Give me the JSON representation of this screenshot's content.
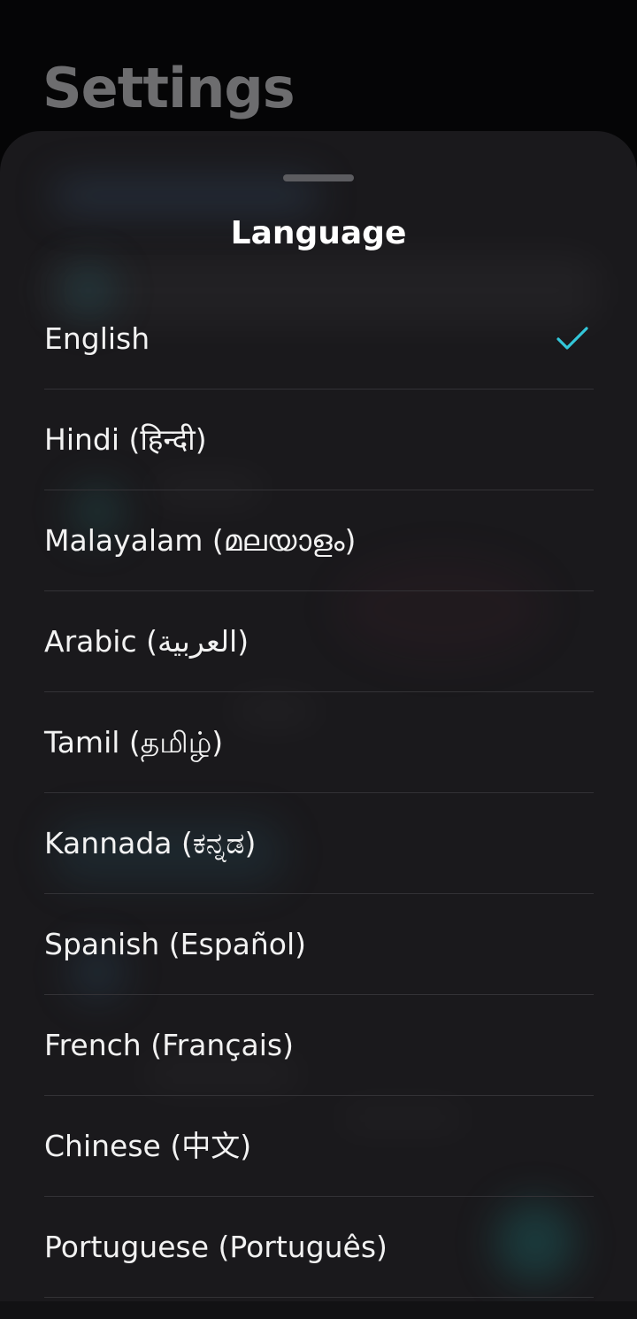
{
  "background": {
    "title": "Settings"
  },
  "sheet": {
    "title": "Language",
    "selected_index": 0,
    "accent_color": "#33c7d9",
    "items": [
      {
        "label": "English",
        "selected": true
      },
      {
        "label": "Hindi (हिन्दी)",
        "selected": false
      },
      {
        "label": "Malayalam (മലയാളം)",
        "selected": false
      },
      {
        "label": "Arabic (العربية)",
        "selected": false
      },
      {
        "label": "Tamil (தமிழ்)",
        "selected": false
      },
      {
        "label": "Kannada (ಕನ್ನಡ)",
        "selected": false
      },
      {
        "label": "Spanish (Español)",
        "selected": false
      },
      {
        "label": "French (Français)",
        "selected": false
      },
      {
        "label": "Chinese (中文)",
        "selected": false
      },
      {
        "label": "Portuguese (Português)",
        "selected": false
      }
    ],
    "icons": {
      "selected": "check-icon",
      "handle": "drag-handle"
    }
  }
}
